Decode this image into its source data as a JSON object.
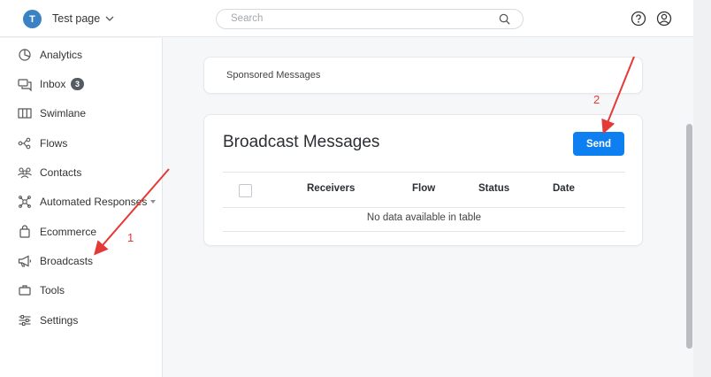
{
  "header": {
    "avatar_letter": "T",
    "page_name": "Test page",
    "search_placeholder": "Search"
  },
  "sidebar": {
    "items": [
      {
        "label": "Analytics",
        "icon": "analytics-icon"
      },
      {
        "label": "Inbox",
        "icon": "inbox-icon",
        "badge": "3"
      },
      {
        "label": "Swimlane",
        "icon": "swimlane-icon"
      },
      {
        "label": "Flows",
        "icon": "flows-icon"
      },
      {
        "label": "Contacts",
        "icon": "contacts-icon"
      },
      {
        "label": "Automated Responses",
        "icon": "automated-responses-icon",
        "has_submenu": true
      },
      {
        "label": "Ecommerce",
        "icon": "ecommerce-icon"
      },
      {
        "label": "Broadcasts",
        "icon": "megaphone-icon"
      },
      {
        "label": "Tools",
        "icon": "tools-icon"
      },
      {
        "label": "Settings",
        "icon": "settings-icon"
      }
    ]
  },
  "main": {
    "sponsored_label": "Sponsored Messages",
    "broadcast_title": "Broadcast Messages",
    "send_label": "Send",
    "table": {
      "columns": [
        "Receivers",
        "Flow",
        "Status",
        "Date"
      ],
      "empty_text": "No data available in table"
    }
  },
  "annotations": {
    "step1": "1",
    "step2": "2",
    "color": "#e53935"
  },
  "colors": {
    "primary": "#0d7ff0",
    "avatar": "#3b82c4"
  }
}
